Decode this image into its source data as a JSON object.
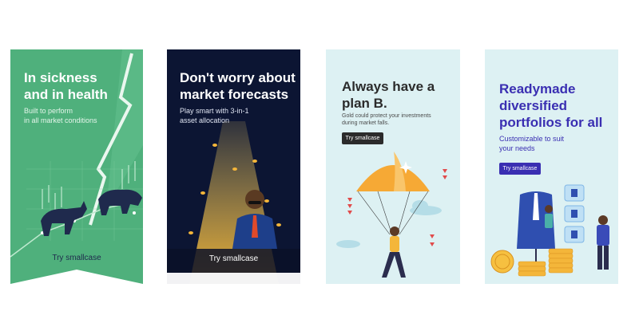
{
  "cards": [
    {
      "id": "sickness",
      "headline_1": "In sickness",
      "headline_2": "and in health",
      "sub_1": "Built to perform",
      "sub_2": "in all market conditions",
      "cta": "Try smallcase",
      "bg": "#4fb07c",
      "text_color": "#ffffff"
    },
    {
      "id": "forecasts",
      "headline_1": "Don't worry about",
      "headline_2": "market forecasts",
      "sub_1": "Play smart with 3-in-1",
      "sub_2": "asset allocation",
      "cta": "Try smallcase",
      "bg": "#0c1533",
      "text_color": "#ffffff"
    },
    {
      "id": "planb",
      "headline_1": "Always have a",
      "headline_2": "plan B.",
      "sub_1": "Gold could protect your investments",
      "sub_2": "during market falls.",
      "cta": "Try smallcase",
      "bg": "#ddf1f3",
      "text_color": "#2b2b2b"
    },
    {
      "id": "readymade",
      "headline_1": "Readymade",
      "headline_2": "diversified",
      "headline_3": "portfolios for all",
      "sub_1": "Customizable to suit",
      "sub_2": "your needs",
      "cta": "Try smallcase",
      "bg": "#ddf1f3",
      "text_color": "#3a2fb2"
    }
  ]
}
